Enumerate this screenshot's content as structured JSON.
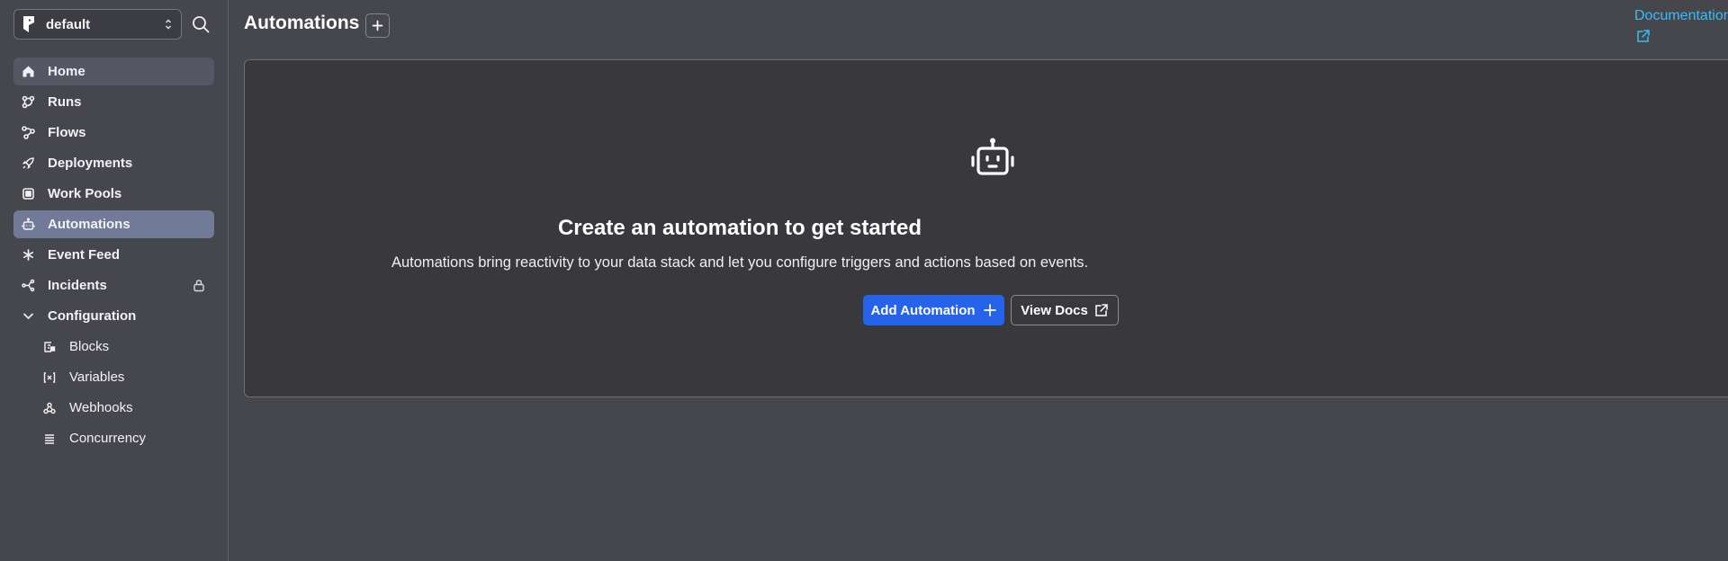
{
  "workspace": {
    "name": "default",
    "logo_icon": "prefect-logo-icon",
    "chevron_icon": "updown-chevron-icon"
  },
  "sidebar": {
    "search_icon": "search-icon",
    "items": [
      {
        "label": "Home",
        "icon": "home-icon"
      },
      {
        "label": "Runs",
        "icon": "runs-icon"
      },
      {
        "label": "Flows",
        "icon": "flows-icon"
      },
      {
        "label": "Deployments",
        "icon": "rocket-icon"
      },
      {
        "label": "Work Pools",
        "icon": "cpu-icon"
      },
      {
        "label": "Automations",
        "icon": "bot-icon"
      },
      {
        "label": "Event Feed",
        "icon": "asterisk-icon"
      },
      {
        "label": "Incidents",
        "icon": "incidents-icon",
        "locked": true
      },
      {
        "label": "Configuration",
        "icon": "chevron-down-icon"
      }
    ],
    "sub_items": [
      {
        "label": "Blocks",
        "icon": "blocks-icon"
      },
      {
        "label": "Variables",
        "icon": "variable-icon"
      },
      {
        "label": "Webhooks",
        "icon": "webhook-icon"
      },
      {
        "label": "Concurrency",
        "icon": "layers-icon"
      }
    ]
  },
  "header": {
    "title": "Automations",
    "add_icon": "plus-icon",
    "docs_link": "Documentation",
    "docs_icon": "external-link-icon"
  },
  "empty_state": {
    "icon": "robot-icon",
    "title": "Create an automation to get started",
    "description": "Automations bring reactivity to your data stack and let you configure triggers and actions based on events.",
    "primary_button": "Add Automation",
    "secondary_button": "View Docs"
  },
  "colors": {
    "background": "#46464d",
    "card": "#38383d",
    "active_nav": "#717a97",
    "primary": "#2563eb",
    "link": "#38bdf8"
  }
}
